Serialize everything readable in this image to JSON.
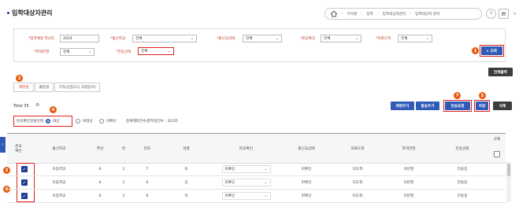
{
  "page": {
    "title": "입학대상자관리"
  },
  "breadcrumb": {
    "items": [
      "부서원",
      "입학",
      "입학대상자관리",
      "입학대상자 관리"
    ]
  },
  "filter": {
    "admission_year_label": "*입학예정 학년도",
    "admission_year_value": "2024",
    "school_label": "*출신학교",
    "school_value": "전체",
    "school_status_label": "*출신교상태",
    "school_status_value": "전체",
    "confirm_label": "*본교확인",
    "confirm_value": "전체",
    "data_arrival_label": "*자료도착",
    "data_arrival_value": "전체",
    "school_year_label": "*학적반영",
    "school_year_value": "전체",
    "transfer_label": "*전송상태",
    "transfer_value": "전체",
    "search_label": "조회"
  },
  "actions": {
    "all_view_label": "전체출력",
    "add_label": "재명추가",
    "notify_label": "발송추가",
    "send_request_label": "전송요청",
    "save_label": "저장",
    "delete_label": "삭제"
  },
  "tabs": [
    {
      "label": "재학생"
    },
    {
      "label": "졸업생"
    },
    {
      "label": "기타(검정고시,직접입력)"
    }
  ],
  "summary": {
    "total": "Total 35",
    "count_text": "중복제외건수/총학생건수 : 35/35"
  },
  "options": {
    "label": "본교확인일괄선택",
    "target": "대상",
    "non_target": "비대상",
    "unconfirmed": "미확인"
  },
  "badges": {
    "b1": "1",
    "b2": "2",
    "b3": "3",
    "b4": "4",
    "b5": "5",
    "b6": "6",
    "b7": "7"
  },
  "table": {
    "headers": [
      "본교\n확인",
      "출신학교",
      "학년",
      "반",
      "번호",
      "성명",
      "본교확인",
      "출신교상태",
      "자료도착",
      "학적반영",
      "전송상태",
      "삭제"
    ],
    "rows": [
      [
        "초등학교",
        "6",
        "1",
        "7",
        "이",
        "미확인",
        "미확인",
        "미도착",
        "미반영",
        "전송중"
      ],
      [
        "초등학교",
        "6",
        "1",
        "6",
        "김",
        "미확인",
        "미확인",
        "미도착",
        "미반영",
        "전송중"
      ],
      [
        "초등학교",
        "6",
        "1",
        "6",
        "이",
        "미확인",
        "미확인",
        "미도착",
        "미반영",
        "전송중"
      ]
    ]
  },
  "colors": {
    "accent": "#2f5bb7",
    "alert": "#e02020",
    "badge": "#e8590c"
  }
}
